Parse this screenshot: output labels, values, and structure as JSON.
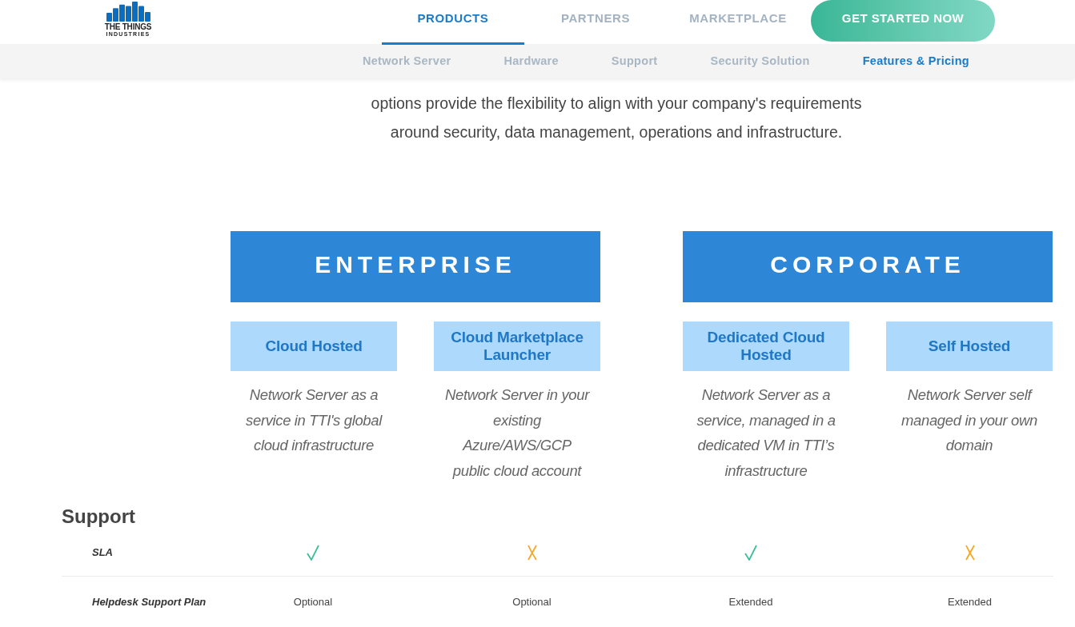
{
  "logo": {
    "name": "THE THINGS",
    "subtitle": "INDUSTRIES"
  },
  "nav": {
    "items": [
      {
        "label": "PRODUCTS",
        "selected": true
      },
      {
        "label": "PARTNERS",
        "selected": false
      },
      {
        "label": "MARKETPLACE",
        "selected": false
      }
    ],
    "cta_button": "GET STARTED NOW"
  },
  "subnav": {
    "items": [
      {
        "label": "Network Server",
        "selected": false
      },
      {
        "label": "Hardware",
        "selected": false
      },
      {
        "label": "Support",
        "selected": false
      },
      {
        "label": "Security Solution",
        "selected": false
      },
      {
        "label": "Features & Pricing",
        "selected": true
      }
    ]
  },
  "intro_lines": [
    "options provide the flexibility to align with your company's requirements",
    "around security, data management, operations and infrastructure."
  ],
  "plans": [
    {
      "title": "ENTERPRISE",
      "options": [
        {
          "title": "Cloud Hosted",
          "description_lines": [
            "Network Server as a",
            "service in TTI's global",
            "cloud infrastructure"
          ]
        },
        {
          "title": "Cloud Marketplace Launcher",
          "description_lines": [
            "Network Server in your",
            "existing",
            "Azure/AWS/GCP",
            "public cloud account"
          ]
        }
      ]
    },
    {
      "title": "CORPORATE",
      "options": [
        {
          "title": "Dedicated Cloud Hosted",
          "description_lines": [
            "Network Server as a",
            "service, managed in a",
            "dedicated VM in TTI’s",
            "infrastructure"
          ]
        },
        {
          "title": "Self Hosted",
          "description_lines": [
            "Network Server self",
            "managed in your own",
            "domain"
          ]
        }
      ]
    }
  ],
  "support": {
    "title": "Support",
    "rows": [
      {
        "label": "SLA",
        "kind": "mark",
        "cells": [
          {
            "included": true
          },
          {
            "included": false
          },
          {
            "included": true
          },
          {
            "included": false
          }
        ]
      },
      {
        "label": "Helpdesk Support Plan",
        "kind": "text",
        "cells": [
          "Optional",
          "Optional",
          "Extended",
          "Extended"
        ]
      }
    ]
  }
}
